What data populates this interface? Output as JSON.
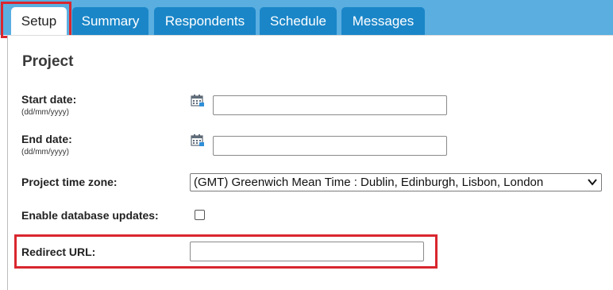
{
  "tabs": [
    {
      "label": "Setup",
      "active": true
    },
    {
      "label": "Summary",
      "active": false
    },
    {
      "label": "Respondents",
      "active": false
    },
    {
      "label": "Schedule",
      "active": false
    },
    {
      "label": "Messages",
      "active": false
    }
  ],
  "section": {
    "title": "Project"
  },
  "fields": {
    "start_date": {
      "label": "Start date:",
      "hint": "(dd/mm/yyyy)",
      "value": ""
    },
    "end_date": {
      "label": "End date:",
      "hint": "(dd/mm/yyyy)",
      "value": ""
    },
    "time_zone": {
      "label": "Project time zone:",
      "selected": "(GMT) Greenwich Mean Time : Dublin, Edinburgh, Lisbon, London"
    },
    "db_updates": {
      "label": "Enable database updates:",
      "checked": false
    },
    "redirect_url": {
      "label": "Redirect URL:",
      "value": ""
    }
  },
  "icons": {
    "calendar": "calendar-icon",
    "dropdown": "chevron-down-icon"
  },
  "colors": {
    "tab_bar": "#5aaee0",
    "tab_inactive": "#1a86c8",
    "highlight": "#d9262e"
  }
}
